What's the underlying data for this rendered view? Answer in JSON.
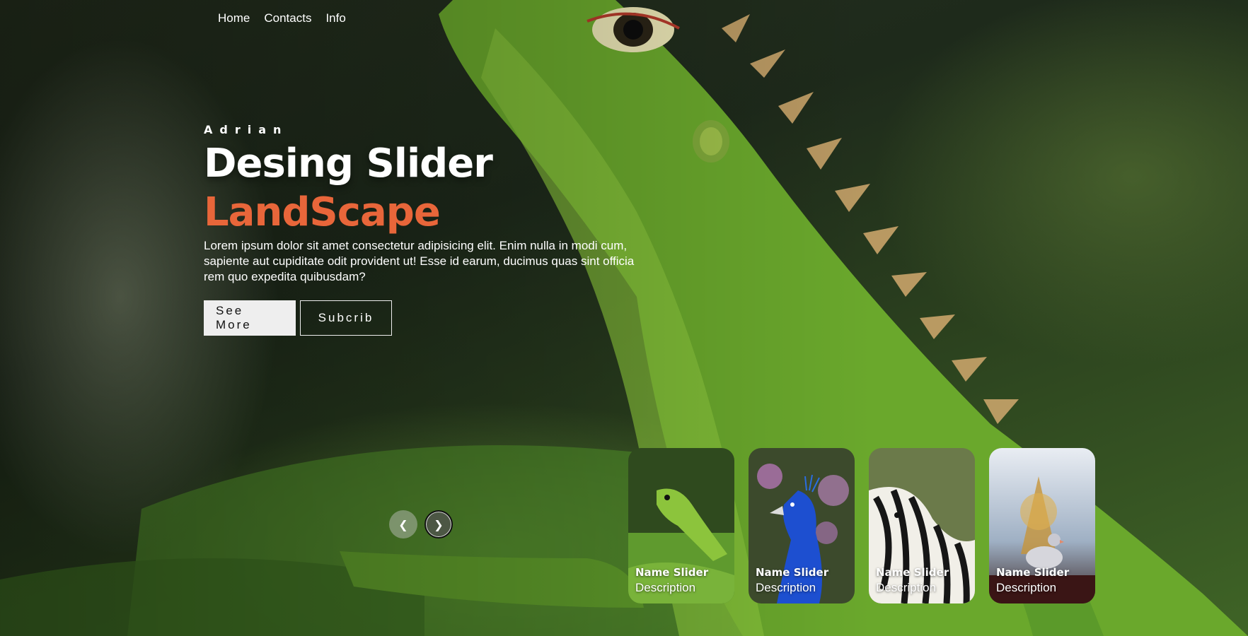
{
  "nav": {
    "items": [
      {
        "label": "Home"
      },
      {
        "label": "Contacts"
      },
      {
        "label": "Info"
      }
    ]
  },
  "hero": {
    "author": "Adrian",
    "title": "Desing Slider",
    "topic": "LandScape",
    "description": "Lorem ipsum dolor sit amet consectetur adipisicing elit. Enim nulla in modi cum, sapiente aut cupiditate odit provident ut! Esse id earum, ducimus quas sint officia rem quo expedita quibusdam?",
    "see_more_label": "See More",
    "subscribe_label": "Subcrib"
  },
  "arrows": {
    "prev_icon": "chevron-left-icon",
    "next_icon": "chevron-right-icon"
  },
  "thumbnails": [
    {
      "name": "Name Slider",
      "description": "Description",
      "image": "lizard-image"
    },
    {
      "name": "Name Slider",
      "description": "Description",
      "image": "peacock-image"
    },
    {
      "name": "Name Slider",
      "description": "Description",
      "image": "zebra-image"
    },
    {
      "name": "Name Slider",
      "description": "Description",
      "image": "pigeon-image"
    }
  ],
  "colors": {
    "accent": "#e8663a",
    "button_primary_bg": "#eeeeee"
  }
}
